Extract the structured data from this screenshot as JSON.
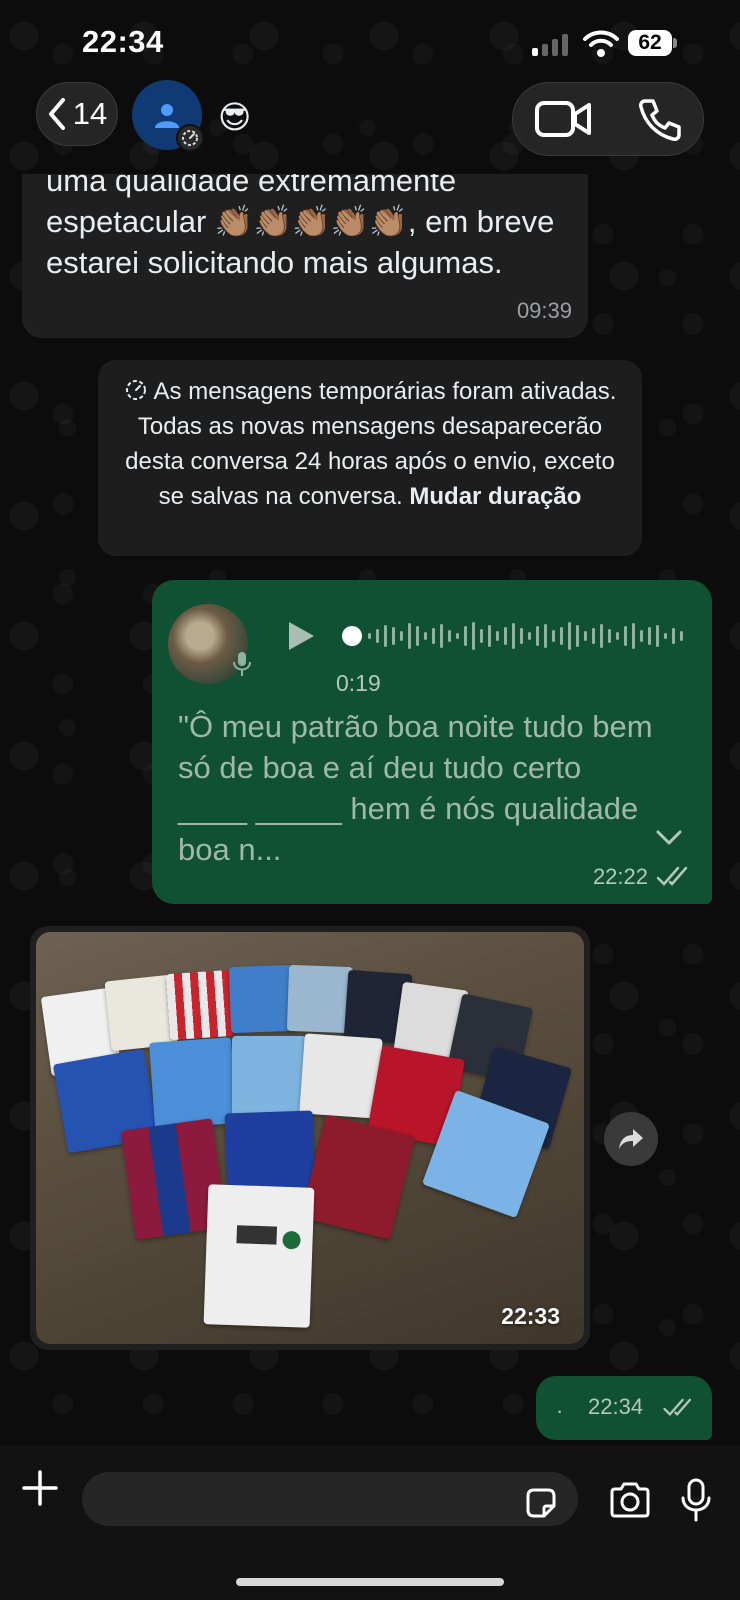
{
  "status_bar": {
    "time": "22:34",
    "battery": "62"
  },
  "header": {
    "back_count": "14",
    "contact_emoji": "😎",
    "icons": [
      "chevron-left-icon",
      "person-icon",
      "timer-icon",
      "video-call-icon",
      "phone-icon"
    ]
  },
  "messages": {
    "incoming_text": {
      "text": "uma qualidade extremamente espetacular 👏🏽👏🏽👏🏽👏🏽👏🏽, em breve estarei solicitando mais algumas.",
      "time": "09:39"
    },
    "system_note": {
      "text": "As mensagens temporárias foram ativadas. Todas as novas mensagens desaparecerão desta conversa 24 horas após o envio, exceto se salvas na conversa.",
      "link": "Mudar duração"
    },
    "voice": {
      "duration": "0:19",
      "transcript": "\"Ô meu patrão boa noite tudo bem só de boa e aí deu tudo certo ____ _____ hem é nós qualidade boa n...",
      "time": "22:22",
      "status": "read"
    },
    "photo": {
      "time": "22:33"
    },
    "outgoing_short": {
      "text": "·",
      "time": "22:34",
      "status": "read"
    }
  },
  "input_bar": {
    "placeholder": "",
    "icons": [
      "plus-icon",
      "sticker-icon",
      "camera-icon",
      "microphone-icon"
    ]
  },
  "colors": {
    "outgoing_bubble": "#0f5132",
    "incoming_bubble": "#1f1f1f",
    "background": "#0b0b0b"
  }
}
